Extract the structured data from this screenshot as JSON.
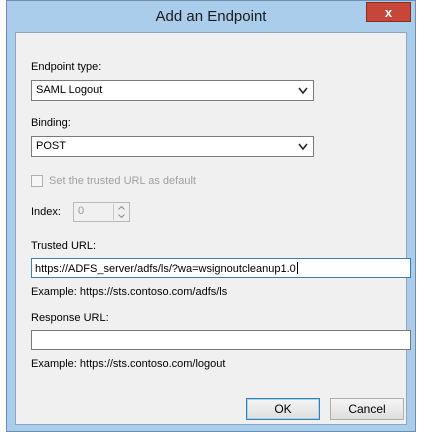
{
  "dialog": {
    "title": "Add an Endpoint",
    "close_label": "x"
  },
  "endpoint_type": {
    "label": "Endpoint type:",
    "selected": "SAML Logout"
  },
  "binding": {
    "label": "Binding:",
    "selected": "POST"
  },
  "default_checkbox": {
    "label": "Set the trusted URL as default",
    "checked": false,
    "enabled": false
  },
  "index": {
    "label": "Index:",
    "value": "0"
  },
  "trusted_url": {
    "label": "Trusted URL:",
    "value": "https://ADFS_server/adfs/ls/?wa=wsignoutcleanup1.0",
    "example": "Example: https://sts.contoso.com/adfs/ls"
  },
  "response_url": {
    "label": "Response URL:",
    "value": "",
    "example": "Example: https://sts.contoso.com/logout"
  },
  "buttons": {
    "ok": "OK",
    "cancel": "Cancel"
  },
  "colors": {
    "frame": "#a9cdea",
    "client": "#f0f0f0",
    "close_button": "#c7463a",
    "focus_border": "#3c7fb1"
  }
}
